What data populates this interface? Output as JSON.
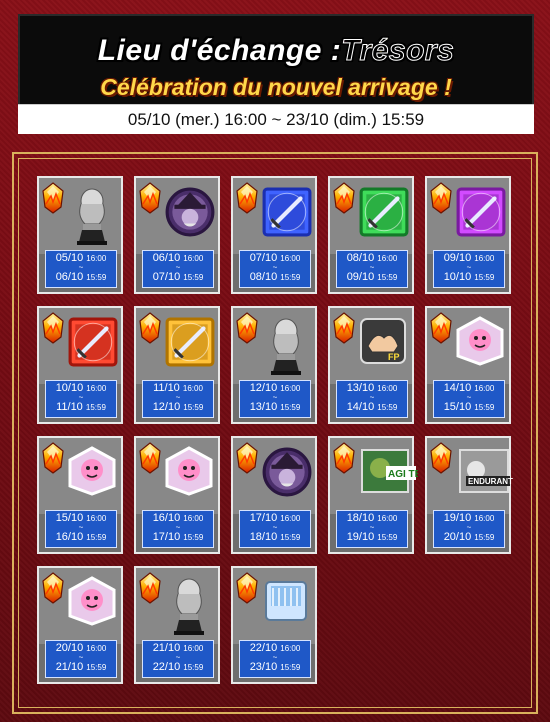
{
  "header": {
    "title_main": "Lieu d'échange :",
    "title_accent": "Trésors",
    "subtitle": "Célébration du nouvel arrivage !",
    "date_range": "05/10 (mer.) 16:00 ~ 23/10 (dim.) 15:59"
  },
  "cards": [
    {
      "item": "silver-trophy-icon",
      "start": "05/10",
      "start_time": "16:00",
      "end": "06/10",
      "end_time": "15:59"
    },
    {
      "item": "medal-icon",
      "start": "06/10",
      "start_time": "16:00",
      "end": "07/10",
      "end_time": "15:59"
    },
    {
      "item": "sword-blue-icon",
      "start": "07/10",
      "start_time": "16:00",
      "end": "08/10",
      "end_time": "15:59"
    },
    {
      "item": "sword-green-icon",
      "start": "08/10",
      "start_time": "16:00",
      "end": "09/10",
      "end_time": "15:59"
    },
    {
      "item": "sword-purple-icon",
      "start": "09/10",
      "start_time": "16:00",
      "end": "10/10",
      "end_time": "15:59"
    },
    {
      "item": "sword-red-icon",
      "start": "10/10",
      "start_time": "16:00",
      "end": "11/10",
      "end_time": "15:59"
    },
    {
      "item": "sword-gold-icon",
      "start": "11/10",
      "start_time": "16:00",
      "end": "12/10",
      "end_time": "15:59"
    },
    {
      "item": "silver-trophy-icon",
      "start": "12/10",
      "start_time": "16:00",
      "end": "13/10",
      "end_time": "15:59"
    },
    {
      "item": "fp-card-icon",
      "start": "13/10",
      "start_time": "16:00",
      "end": "14/10",
      "end_time": "15:59"
    },
    {
      "item": "character-card-icon",
      "start": "14/10",
      "start_time": "16:00",
      "end": "15/10",
      "end_time": "15:59"
    },
    {
      "item": "character-card-icon",
      "start": "15/10",
      "start_time": "16:00",
      "end": "16/10",
      "end_time": "15:59"
    },
    {
      "item": "character-card-icon",
      "start": "16/10",
      "start_time": "16:00",
      "end": "17/10",
      "end_time": "15:59"
    },
    {
      "item": "medal-icon",
      "start": "17/10",
      "start_time": "16:00",
      "end": "18/10",
      "end_time": "15:59"
    },
    {
      "item": "agi-teq-card-icon",
      "start": "18/10",
      "start_time": "16:00",
      "end": "19/10",
      "end_time": "15:59"
    },
    {
      "item": "endurant-card-icon",
      "start": "19/10",
      "start_time": "16:00",
      "end": "20/10",
      "end_time": "15:59"
    },
    {
      "item": "character-card-icon",
      "start": "20/10",
      "start_time": "16:00",
      "end": "21/10",
      "end_time": "15:59"
    },
    {
      "item": "silver-trophy-icon",
      "start": "21/10",
      "start_time": "16:00",
      "end": "22/10",
      "end_time": "15:59"
    },
    {
      "item": "crystal-card-icon",
      "start": "22/10",
      "start_time": "16:00",
      "end": "23/10",
      "end_time": "15:59"
    }
  ],
  "card_labels": {
    "agi_teq": "AGI TEQ",
    "endurant": "ENDURANT",
    "fp": "FP"
  },
  "colors": {
    "background": "#7a0c14",
    "frame": "#d9b15c",
    "date_box": "#1f58c7",
    "card": "#6e6e6e"
  }
}
